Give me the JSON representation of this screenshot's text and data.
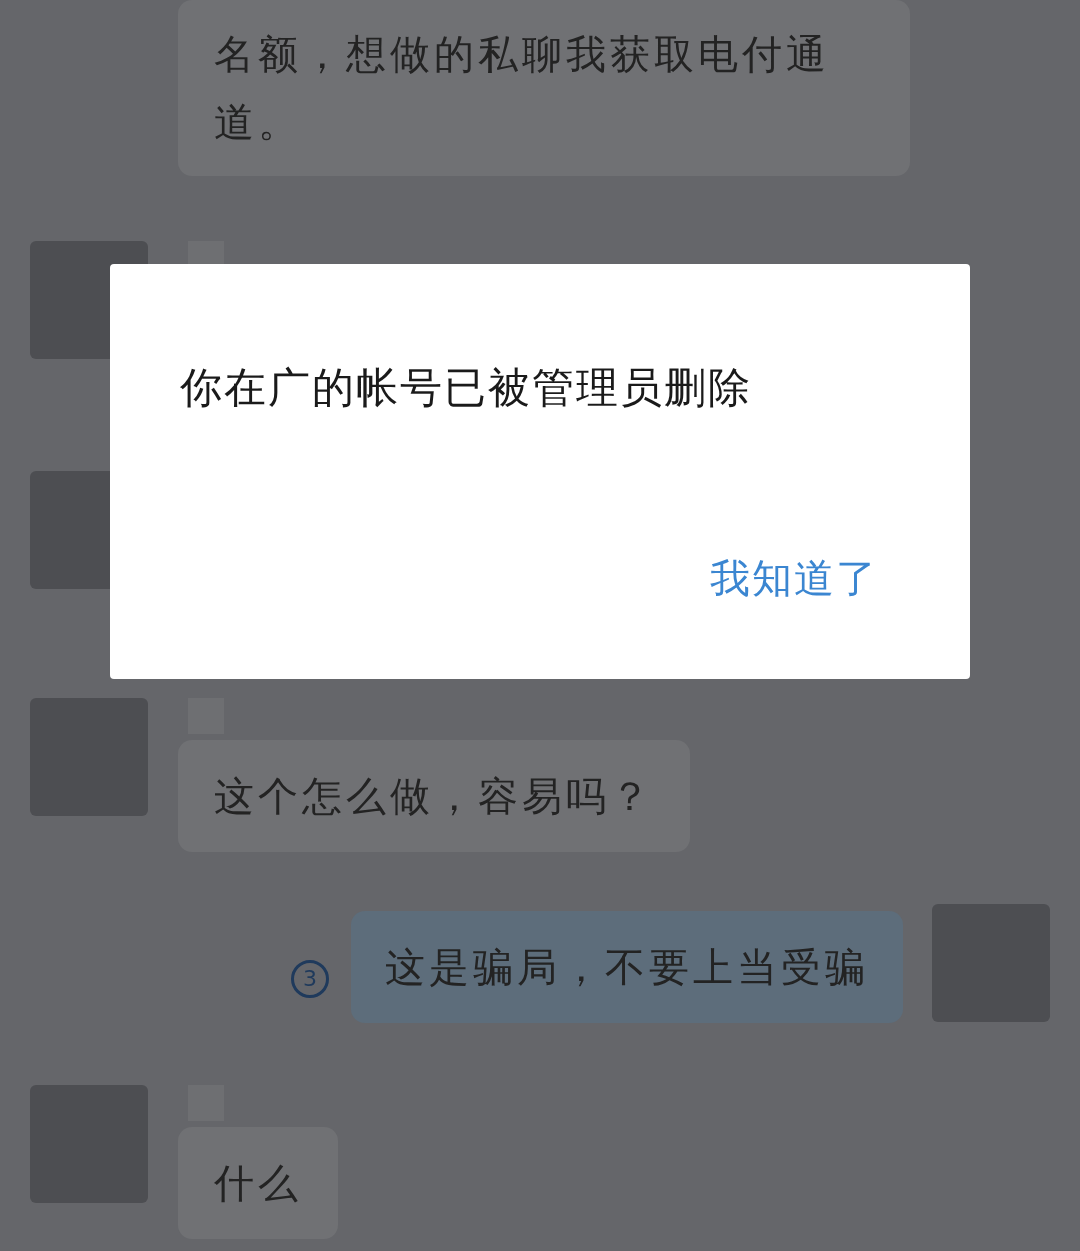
{
  "messages": [
    {
      "kind": "continued",
      "text": "名额，想做的私聊我获取电付通道。"
    },
    {
      "kind": "incoming"
    },
    {
      "kind": "avatar_only"
    },
    {
      "kind": "incoming",
      "text": "这个怎么做，容易吗？"
    },
    {
      "kind": "outgoing",
      "read_count": "3",
      "text": "这是骗局，不要上当受骗"
    },
    {
      "kind": "incoming",
      "text": "什么"
    }
  ],
  "dialog": {
    "message": "你在广的帐号已被管理员删除",
    "button": "我知道了"
  }
}
